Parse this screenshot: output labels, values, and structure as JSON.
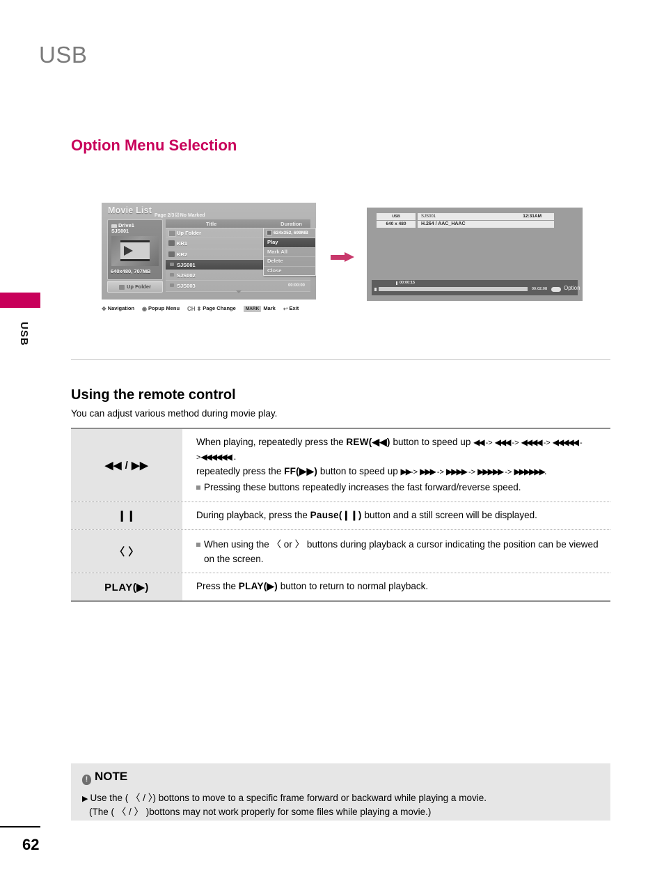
{
  "page": {
    "title": "USB",
    "side_tab_label": "USB",
    "number": "62"
  },
  "section": {
    "heading": "Option Menu Selection"
  },
  "osd_movie_list": {
    "title": "Movie List",
    "page_info_prefix": "Page 2/3",
    "page_info_mark": "☑",
    "page_info_suffix": "No Marked",
    "drive_label": "Drive1",
    "drive_file": "SJS001",
    "drive_resolution": "640x480, 707MB",
    "up_folder_button": "Up Folder",
    "columns": {
      "title": "Title",
      "duration": "Duration"
    },
    "rows": [
      {
        "label": "Up Folder",
        "icon": "up-folder-icon",
        "duration": "",
        "selected": false
      },
      {
        "label": "KR1",
        "icon": "folder-icon",
        "duration": "",
        "selected": false
      },
      {
        "label": "KR2",
        "icon": "folder-icon",
        "duration": "",
        "selected": false
      },
      {
        "label": "SJS001",
        "icon": "file-icon",
        "duration": "",
        "selected": true
      },
      {
        "label": "SJS002",
        "icon": "file-icon",
        "duration": "",
        "selected": false
      },
      {
        "label": "SJS003",
        "icon": "file-icon",
        "duration": "00:00:00",
        "selected": false
      }
    ],
    "popup": {
      "info": "624x352,  699MB",
      "items": [
        {
          "label": "Play",
          "active": true
        },
        {
          "label": "Mark All",
          "active": false
        },
        {
          "label": "Delete",
          "active": false
        },
        {
          "label": "Close",
          "active": false
        }
      ]
    },
    "nav_legend": [
      {
        "icon": "navigation-dpad-icon",
        "label": "Navigation"
      },
      {
        "icon": "popup-menu-icon",
        "label": "Popup Menu"
      },
      {
        "icon": "ch-updown-icon",
        "prefix": "CH",
        "label": "Page Change"
      },
      {
        "icon": "mark-key-icon",
        "badge": "MARK",
        "label": "Mark"
      },
      {
        "icon": "exit-icon",
        "label": "Exit"
      }
    ]
  },
  "osd_playback": {
    "source": "USB",
    "resolution": "640 x 480",
    "file_name": "SJS001",
    "clock": "12:31AM",
    "codec": "H.264 / AAC_HAAC",
    "current_time": "00:00:15",
    "total_time": "00:02:08",
    "option_label": "Option"
  },
  "remote_control": {
    "heading": "Using the remote control",
    "description": "You can adjust various method during movie play.",
    "rows": [
      {
        "key": "◀◀ / ▶▶",
        "lines": [
          {
            "type": "text",
            "segments": [
              {
                "t": "When playing, repeatedly press the "
              },
              {
                "t": "REW(◀◀)",
                "style": "mono"
              },
              {
                "t": " button to speed up "
              },
              {
                "t": "◀◀",
                "style": "tri"
              },
              {
                "t": " -> "
              },
              {
                "t": "◀◀◀",
                "style": "tri"
              },
              {
                "t": " -> "
              },
              {
                "t": "◀◀◀◀",
                "style": "tri"
              },
              {
                "t": " -> "
              },
              {
                "t": "◀◀◀◀◀",
                "style": "tri"
              },
              {
                "t": " ->"
              },
              {
                "t": "◀◀◀◀◀◀",
                "style": "tri"
              },
              {
                "t": " ."
              }
            ]
          },
          {
            "type": "text",
            "segments": [
              {
                "t": "repeatedly press the "
              },
              {
                "t": "FF(▶▶)",
                "style": "mono"
              },
              {
                "t": " button to speed up "
              },
              {
                "t": "▶▶",
                "style": "tri"
              },
              {
                "t": "-> "
              },
              {
                "t": "▶▶▶",
                "style": "tri"
              },
              {
                "t": " -> "
              },
              {
                "t": "▶▶▶▶",
                "style": "tri"
              },
              {
                "t": " -> "
              },
              {
                "t": "▶▶▶▶▶",
                "style": "tri"
              },
              {
                "t": " -> "
              },
              {
                "t": "▶▶▶▶▶▶",
                "style": "tri"
              },
              {
                "t": "."
              }
            ]
          },
          {
            "type": "bullet",
            "segments": [
              {
                "t": "Pressing these buttons repeatedly increases the fast forward/reverse speed."
              }
            ]
          }
        ]
      },
      {
        "key": "❙❙",
        "lines": [
          {
            "type": "text",
            "segments": [
              {
                "t": "During playback, press the "
              },
              {
                "t": "Pause(❙❙)",
                "style": "mono"
              },
              {
                "t": " button and a still screen will be displayed."
              }
            ]
          }
        ]
      },
      {
        "key": "〈 〉",
        "lines": [
          {
            "type": "bullet",
            "segments": [
              {
                "t": "When using the  〈 or 〉  buttons during playback a cursor indicating the position can be viewed on the screen."
              }
            ]
          }
        ]
      },
      {
        "key": "PLAY(▶)",
        "lines": [
          {
            "type": "text",
            "segments": [
              {
                "t": "Press the "
              },
              {
                "t": "PLAY(▶)",
                "style": "mono"
              },
              {
                "t": " button to return to normal playback."
              }
            ]
          }
        ]
      }
    ]
  },
  "note": {
    "icon": "exclamation-icon",
    "title": "NOTE",
    "caret": "▶",
    "line1": "Use the ( 〈 / 〉) bottons to move to a specific frame forward or backward while playing a movie.",
    "line2": "(The ( 〈 / 〉 )bottons may not work properly for some files while playing a movie.)"
  },
  "colors": {
    "accent": "#c8005a",
    "arrow": "#c8386b",
    "title_gray": "#7b7b7b",
    "note_bg": "#e6e6e6",
    "table_key_bg": "#e4e4e4"
  }
}
